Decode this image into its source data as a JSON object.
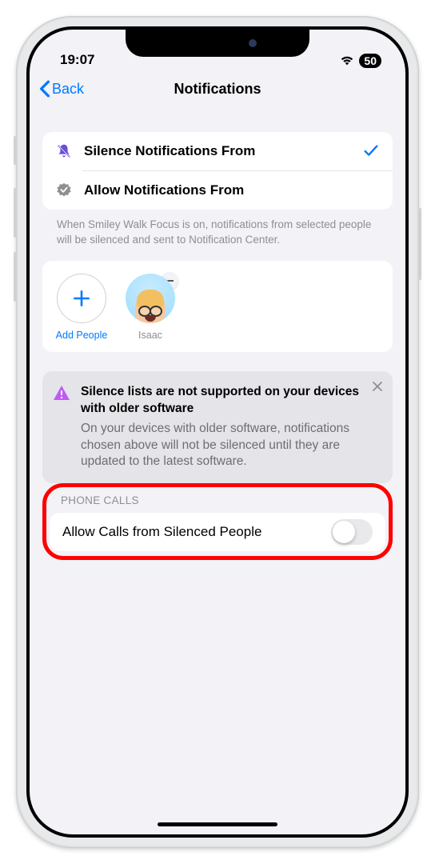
{
  "status": {
    "time": "19:07",
    "battery": "50"
  },
  "nav": {
    "back": "Back",
    "title": "Notifications"
  },
  "options": {
    "silence": "Silence Notifications From",
    "allow": "Allow Notifications From"
  },
  "footer": "When Smiley Walk Focus is on, notifications from selected people will be silenced and sent to Notification Center.",
  "people": {
    "add": "Add People",
    "items": [
      {
        "name": "Isaac"
      }
    ]
  },
  "warning": {
    "title": "Silence lists are not supported on your devices with older software",
    "body": "On your devices with older software, notifications chosen above will not be silenced until they are updated to the latest software."
  },
  "phone_section": {
    "header": "Phone Calls",
    "toggle_label": "Allow Calls from Silenced People"
  }
}
